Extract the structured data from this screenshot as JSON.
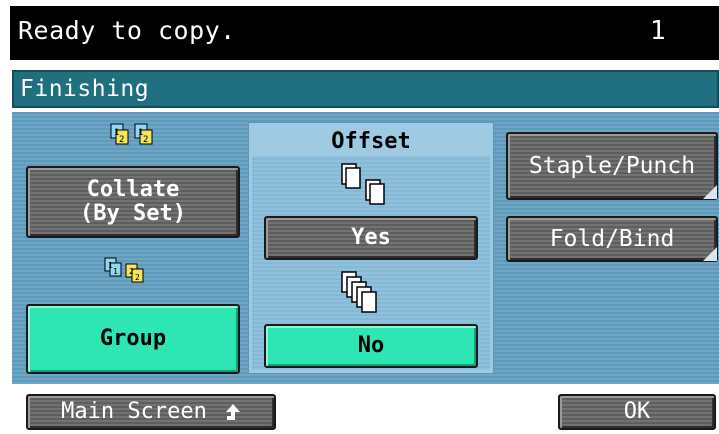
{
  "status": {
    "message": "Ready to copy.",
    "copy_count": "1"
  },
  "screen_title": "Finishing",
  "sorting": {
    "collate_label_line1": "Collate",
    "collate_label_line2": "(By Set)",
    "group_label": "Group",
    "selected": "Group"
  },
  "offset": {
    "label": "Offset",
    "yes_label": "Yes",
    "no_label": "No",
    "selected": "No"
  },
  "options": {
    "staple_label": "Staple/Punch",
    "fold_label": "Fold/Bind"
  },
  "footer": {
    "main_screen_label": "Main Screen",
    "ok_label": "OK"
  },
  "colors": {
    "selected": "#2ee6b4",
    "title_bar": "#1f6f80",
    "panel": "#6ca5c6"
  },
  "icons": [
    "collate-icon",
    "group-icon",
    "offset-yes-icon",
    "offset-no-icon",
    "return-arrow-icon"
  ]
}
